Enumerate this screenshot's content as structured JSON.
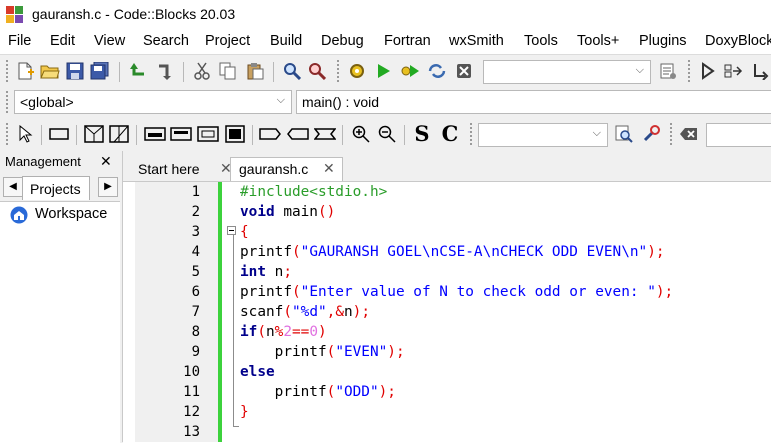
{
  "window": {
    "title": "gauransh.c - Code::Blocks 20.03"
  },
  "menu": [
    "File",
    "Edit",
    "View",
    "Search",
    "Project",
    "Build",
    "Debug",
    "Fortran",
    "wxSmith",
    "Tools",
    "Tools+",
    "Plugins",
    "DoxyBlocks"
  ],
  "toolbar": {
    "scope_combo": "<global>",
    "function_combo": "main() : void",
    "search_combo": "",
    "build_target_combo": "",
    "font_letters": [
      "S",
      "C"
    ]
  },
  "management": {
    "title": "Management",
    "close": "✕",
    "tab": "Projects",
    "workspace": "Workspace"
  },
  "editor": {
    "tabs": [
      {
        "label": "Start here",
        "close": "✕"
      },
      {
        "label": "gauransh.c",
        "close": "✕"
      }
    ],
    "line_numbers": [
      "1",
      "2",
      "3",
      "4",
      "5",
      "6",
      "7",
      "8",
      "9",
      "10",
      "11",
      "12",
      "13"
    ]
  },
  "colors": {
    "keyword": "#00008b",
    "string": "#0000ff",
    "preprocessor": "#2a9d2a",
    "operator": "#e00000",
    "number": "#e070e0",
    "change_bar": "#3cd23c"
  }
}
